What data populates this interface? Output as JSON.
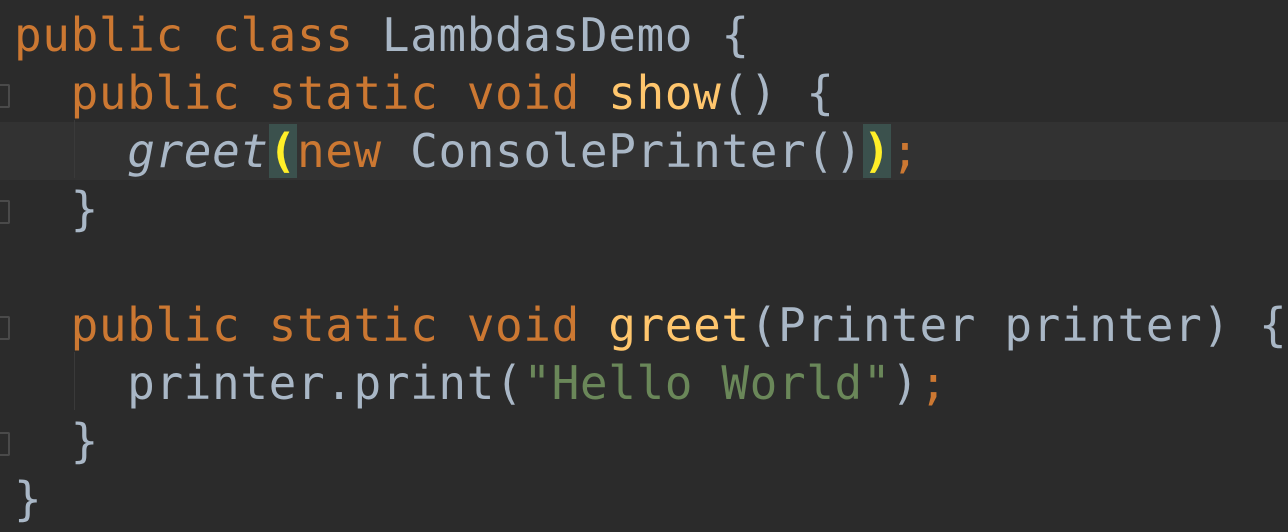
{
  "editor": {
    "lines": [
      {
        "segments": [
          {
            "t": "public ",
            "c": "kw"
          },
          {
            "t": "class ",
            "c": "kw"
          },
          {
            "t": "LambdasDemo ",
            "c": "plain"
          },
          {
            "t": "{",
            "c": "plain"
          }
        ]
      },
      {
        "segments": [
          {
            "t": "  public ",
            "c": "kw"
          },
          {
            "t": "static ",
            "c": "kw"
          },
          {
            "t": "void ",
            "c": "kw"
          },
          {
            "t": "show",
            "c": "fn"
          },
          {
            "t": "() {",
            "c": "plain"
          }
        ]
      },
      {
        "segments": [
          {
            "t": "    ",
            "c": "plain"
          },
          {
            "t": "greet",
            "c": "plain it"
          },
          {
            "t": "(",
            "c": "brace-hl"
          },
          {
            "t": "new ",
            "c": "kw"
          },
          {
            "t": "ConsolePrinter()",
            "c": "plain"
          },
          {
            "t": ")",
            "c": "brace-hl"
          },
          {
            "t": ";",
            "c": "kw"
          }
        ]
      },
      {
        "segments": [
          {
            "t": "  }",
            "c": "plain"
          }
        ]
      },
      {
        "segments": []
      },
      {
        "segments": [
          {
            "t": "  public ",
            "c": "kw"
          },
          {
            "t": "static ",
            "c": "kw"
          },
          {
            "t": "void ",
            "c": "kw"
          },
          {
            "t": "greet",
            "c": "fn"
          },
          {
            "t": "(Printer printer) {",
            "c": "plain"
          }
        ]
      },
      {
        "segments": [
          {
            "t": "    printer.print(",
            "c": "plain"
          },
          {
            "t": "\"Hello World\"",
            "c": "str"
          },
          {
            "t": ")",
            "c": "plain"
          },
          {
            "t": ";",
            "c": "kw"
          }
        ]
      },
      {
        "segments": [
          {
            "t": "  }",
            "c": "plain"
          }
        ]
      },
      {
        "segments": [
          {
            "t": "}",
            "c": "plain"
          }
        ]
      }
    ]
  }
}
